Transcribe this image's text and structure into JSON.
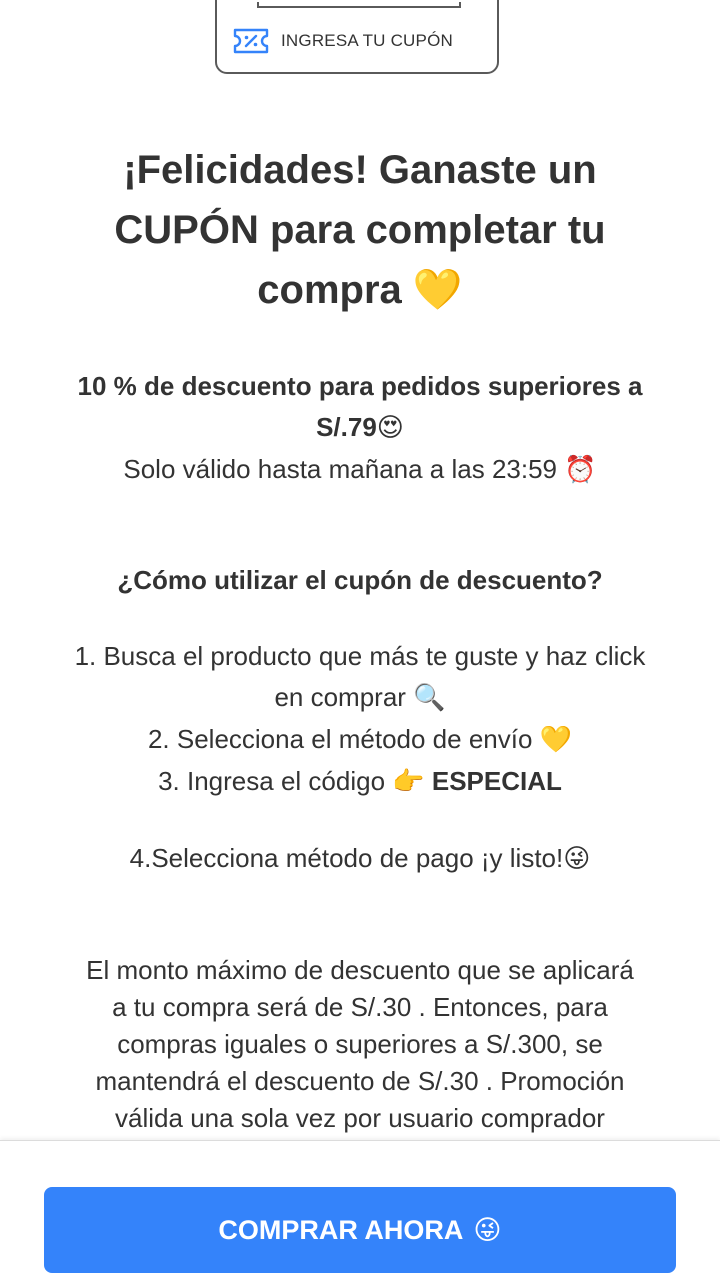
{
  "coupon": {
    "label": "INGRESA TU CUPÓN",
    "icon": "ticket-percent-icon",
    "icon_color": "#3483fa"
  },
  "headline": {
    "line1": "¡Felicidades! Ganaste un",
    "line2": "CUPÓN para completar tu",
    "line3": "compra",
    "emoji": "💛"
  },
  "offer": {
    "line1": "10 % de descuento para pedidos superiores a",
    "line2": "S/.79",
    "line2_emoji": "😍",
    "line3": "Solo válido hasta mañana a las 23:59",
    "line3_emoji": "⏰"
  },
  "howto": {
    "title": "¿Cómo utilizar el cupón de descuento?"
  },
  "steps": {
    "s1_a": "1. Busca el producto que más te guste y haz click",
    "s1_b": "en comprar",
    "s1_emoji": "🔍",
    "s2": "2. Selecciona el método de envío",
    "s2_emoji": "💛",
    "s3": "3. Ingresa el código",
    "s3_emoji": "👉",
    "s3_code": "ESPECIAL",
    "s4": "4.Selecciona método de pago ¡y listo!",
    "s4_emoji": "😜"
  },
  "terms": {
    "l1": "El monto máximo de descuento que se aplicará",
    "l2": "a tu compra será de S/.30 . Entonces, para",
    "l3": "compras iguales o superiores a S/.300, se",
    "l4": "mantendrá el descuento de S/.30 . Promoción",
    "l5": "válida una sola vez por usuario comprador"
  },
  "cta": {
    "label": "COMPRAR AHORA",
    "emoji": "😜",
    "color": "#3483fa"
  }
}
